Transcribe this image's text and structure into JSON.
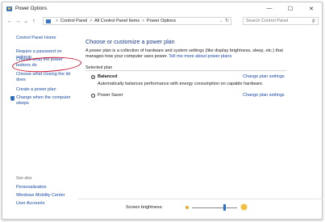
{
  "window": {
    "title": "Power Options",
    "controls": {
      "minimize": "—",
      "maximize": "☐",
      "close": "✕"
    }
  },
  "nav": {
    "back": "←",
    "forward": "→",
    "recent": "⌄",
    "up": "↑"
  },
  "address": {
    "crumbs": [
      "Control Panel",
      "All Control Panel Items",
      "Power Options"
    ],
    "separator": ">",
    "dropdown": "⌄",
    "refresh": "↻"
  },
  "search": {
    "placeholder": "Search Control Panel",
    "icon": "search-icon"
  },
  "sidebar": {
    "home": "Control Panel Home",
    "links": [
      "Require a password on wakeup",
      "Choose what the power buttons do",
      "Choose what closing the lid does",
      "Create a power plan",
      "Change when the computer sleeps"
    ],
    "see_also": {
      "label": "See also",
      "links": [
        "Personalization",
        "Windows Mobility Center",
        "User Accounts"
      ]
    }
  },
  "main": {
    "heading": "Choose or customize a power plan",
    "description": "A power plan is a collection of hardware and system settings (like display brightness, sleep, etc.) that manages how your computer uses power.",
    "description_link": "Tell me more about power plans",
    "selected_plan_label": "Selected plan",
    "plans": [
      {
        "name": "Balanced",
        "selected": true,
        "description": "Automatically balances performance with energy consumption on capable hardware.",
        "change_link": "Change plan settings"
      },
      {
        "name": "Power Saver",
        "selected": false,
        "description": "",
        "change_link": "Change plan settings"
      }
    ]
  },
  "status": {
    "brightness_label": "Screen brightness:",
    "brightness_level": 0.73
  },
  "colors": {
    "link": "#1a4aa8",
    "heading": "#1a3a8a",
    "annotation": "#c8102e",
    "slider_thumb": "#2b6fc8"
  }
}
